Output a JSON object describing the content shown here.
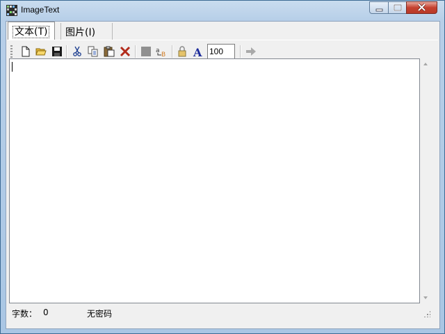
{
  "window": {
    "title": "ImageText"
  },
  "tabs": [
    {
      "label": "文本(T)",
      "active": true
    },
    {
      "label": "图片(I)",
      "active": false
    }
  ],
  "toolbar": {
    "buttons": [
      {
        "name": "new-file",
        "icon": "new-file-icon"
      },
      {
        "name": "open-folder",
        "icon": "open-folder-icon"
      },
      {
        "name": "save",
        "icon": "save-icon"
      },
      {
        "name": "cut",
        "icon": "scissors-icon"
      },
      {
        "name": "copy",
        "icon": "copy-icon"
      },
      {
        "name": "paste",
        "icon": "paste-icon"
      },
      {
        "name": "delete",
        "icon": "delete-x-icon"
      },
      {
        "name": "grid",
        "icon": "grid-icon"
      },
      {
        "name": "text-convert",
        "icon": "ab-convert-icon"
      },
      {
        "name": "password",
        "icon": "lock-icon"
      },
      {
        "name": "font",
        "icon": "font-a-icon"
      },
      {
        "name": "go",
        "icon": "arrow-right-icon"
      }
    ],
    "zoom_value": "100"
  },
  "editor": {
    "content": ""
  },
  "statusbar": {
    "wordcount_label": "字数：",
    "wordcount_value": "0",
    "password_status": "无密码"
  },
  "colors": {
    "titlebar": "#b7cfe8",
    "close_button": "#c4412f",
    "font_icon": "#1b2a9a",
    "delete_icon": "#b22a1a"
  }
}
